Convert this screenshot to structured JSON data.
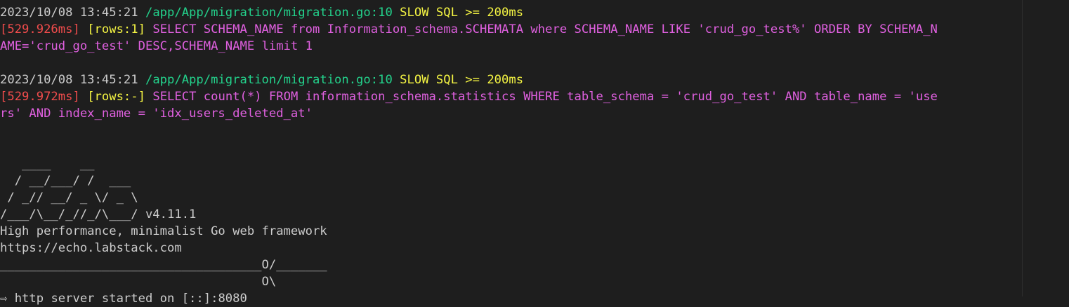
{
  "log_entries": [
    {
      "timestamp": "2023/10/08 13:45:21",
      "source": "/app/App/migration/migration.go:10",
      "level_label": "SLOW SQL >= 200ms",
      "duration": "[529.926ms]",
      "rows": "[rows:1]",
      "sql_line1": "SELECT SCHEMA_NAME from Information_schema.SCHEMATA where SCHEMA_NAME LIKE 'crud_go_test%' ORDER BY SCHEMA_N",
      "sql_line2": "AME='crud_go_test' DESC,SCHEMA_NAME limit 1"
    },
    {
      "timestamp": "2023/10/08 13:45:21",
      "source": "/app/App/migration/migration.go:10",
      "level_label": "SLOW SQL >= 200ms",
      "duration": "[529.972ms]",
      "rows": "[rows:-]",
      "sql_line1": "SELECT count(*) FROM information_schema.statistics WHERE table_schema = 'crud_go_test' AND table_name = 'use",
      "sql_line2": "rs' AND index_name = 'idx_users_deleted_at'"
    }
  ],
  "banner": {
    "art_line1": "   ____    __",
    "art_line2": "  / __/___/ /  ___",
    "art_line3": " / _// __/ _ \\/ _ \\",
    "art_line4": "/___/\\__/_//_/\\___/",
    "version": " v4.11.1",
    "tagline": "High performance, minimalist Go web framework",
    "url": "https://echo.labstack.com",
    "rule_line1": "____________________________________O/_______",
    "rule_line2": "                                    O\\"
  },
  "server": {
    "arrow": "⇨",
    "message": " http server started on [::]:8080"
  },
  "colors": {
    "background": "#1e1e1e",
    "default_text": "#cccccc",
    "path": "#23d18b",
    "warning": "#f5f543",
    "duration": "#f14c4c",
    "sql": "#e060e0"
  }
}
